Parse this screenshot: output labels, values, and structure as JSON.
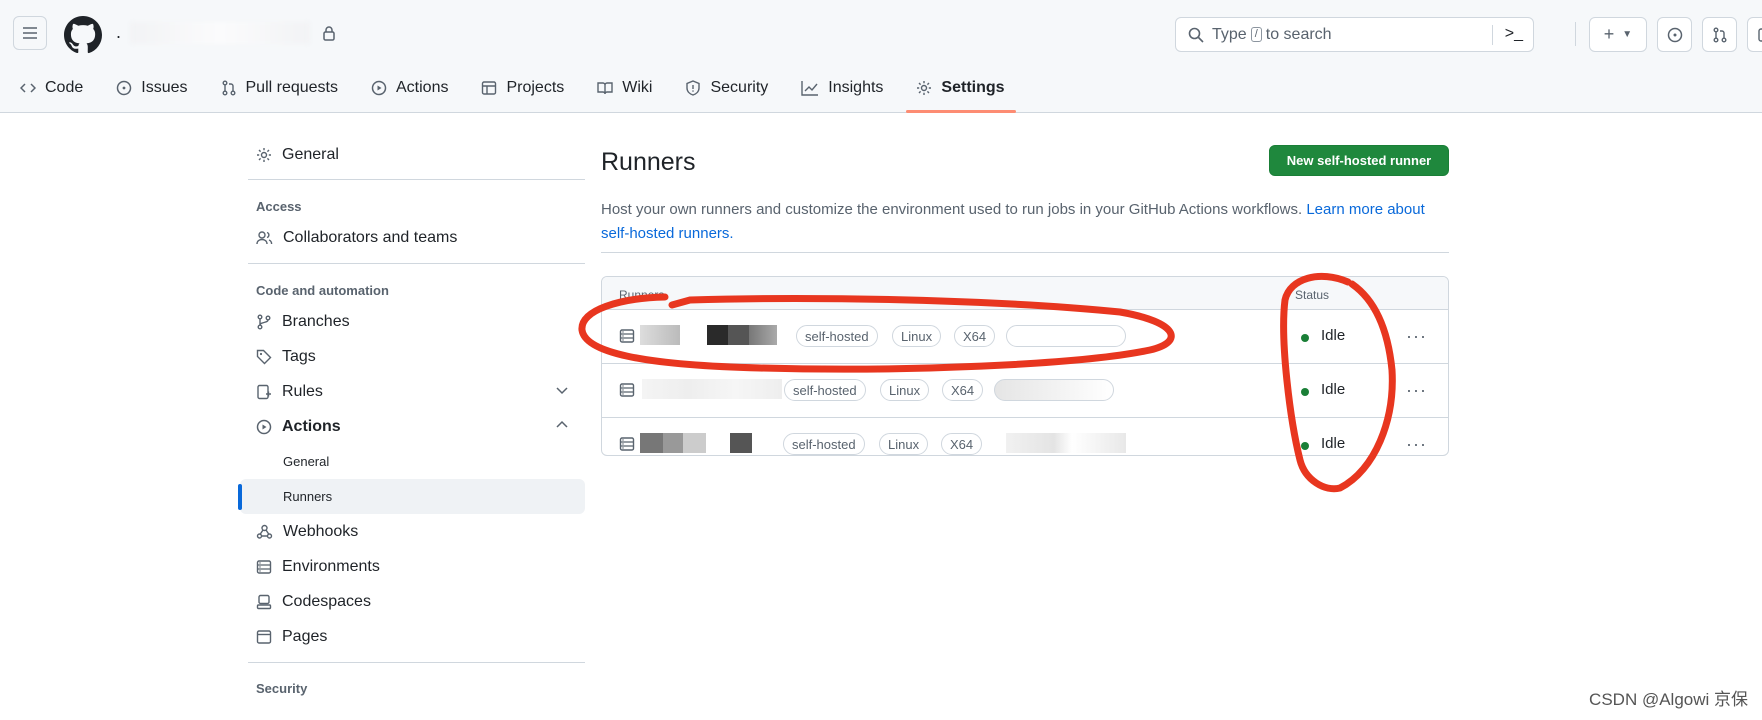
{
  "header": {
    "repo_prefix": ".",
    "search_placeholder_before": "Type",
    "search_key": "/",
    "search_placeholder_after": "to search",
    "create_label": "+",
    "terminal_icon": "terminal-icon"
  },
  "tabs": [
    {
      "label": "Code",
      "icon": "code-icon"
    },
    {
      "label": "Issues",
      "icon": "issue-icon"
    },
    {
      "label": "Pull requests",
      "icon": "pull-request-icon"
    },
    {
      "label": "Actions",
      "icon": "play-icon"
    },
    {
      "label": "Projects",
      "icon": "table-icon"
    },
    {
      "label": "Wiki",
      "icon": "book-icon"
    },
    {
      "label": "Security",
      "icon": "shield-icon"
    },
    {
      "label": "Insights",
      "icon": "graph-icon"
    },
    {
      "label": "Settings",
      "icon": "gear-icon",
      "selected": true
    }
  ],
  "sidebar": {
    "general": "General",
    "access_heading": "Access",
    "collaborators": "Collaborators and teams",
    "code_heading": "Code and automation",
    "branches": "Branches",
    "tags": "Tags",
    "rules": "Rules",
    "actions": "Actions",
    "actions_general": "General",
    "actions_runners": "Runners",
    "webhooks": "Webhooks",
    "environments": "Environments",
    "codespaces": "Codespaces",
    "pages": "Pages",
    "security_heading": "Security"
  },
  "main": {
    "title": "Runners",
    "new_button": "New self-hosted runner",
    "description": "Host your own runners and customize the environment used to run jobs in your GitHub Actions workflows.",
    "learn_more": "Learn more about self-hosted runners.",
    "table": {
      "col_runners": "Runners",
      "col_status": "Status",
      "rows": [
        {
          "labels": [
            "self-hosted",
            "Linux",
            "X64"
          ],
          "status": "Idle"
        },
        {
          "labels": [
            "self-hosted",
            "Linux",
            "X64"
          ],
          "status": "Idle"
        },
        {
          "labels": [
            "self-hosted",
            "Linux",
            "X64"
          ],
          "status": "Idle"
        }
      ]
    }
  },
  "colors": {
    "accent_green": "#1f883d",
    "link_blue": "#0969da",
    "tab_underline": "#fd8c73",
    "annotation_red": "#e8361f"
  },
  "watermark": "CSDN @Algowi 京保"
}
